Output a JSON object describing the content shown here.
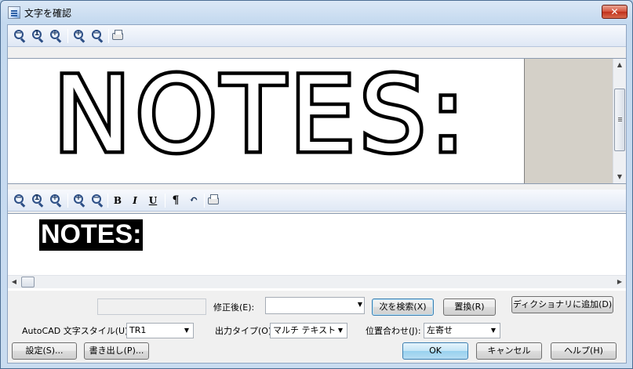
{
  "window": {
    "title": "文字を確認",
    "close_glyph": "✕"
  },
  "preview_toolbar": {
    "buttons": [
      {
        "name": "zoom-out-icon",
        "sign": "−"
      },
      {
        "name": "zoom-actual-icon",
        "sign": "1"
      },
      {
        "name": "zoom-fit-icon",
        "sign": "+"
      },
      {
        "name": "zoom-in-icon",
        "sign": "+"
      },
      {
        "name": "zoom-out-small-icon",
        "sign": "−"
      }
    ],
    "print_icon": "printer-icon"
  },
  "preview": {
    "scanned_text": "NOTES:"
  },
  "editor_toolbar": {
    "bold": "B",
    "italic": "I",
    "underline": "U",
    "pilcrow": "¶",
    "undo": "↶"
  },
  "editor": {
    "text": "NOTES:"
  },
  "correction": {
    "label": "修正後(E):",
    "value": "",
    "find_next": "次を検索(X)",
    "replace": "置換(R)",
    "add_to_dictionary": "ディクショナリに追加(D)"
  },
  "options": {
    "text_style_label": "AutoCAD 文字スタイル(U):",
    "text_style_value": "TR1",
    "output_type_label": "出力タイプ(O):",
    "output_type_value": "マルチ テキスト",
    "alignment_label": "位置合わせ(J):",
    "alignment_value": "左寄せ"
  },
  "footer": {
    "settings": "設定(S)...",
    "export": "書き出し(P)...",
    "ok": "OK",
    "cancel": "キャンセル",
    "help": "ヘルプ(H)"
  },
  "scroll": {
    "up": "▲",
    "down": "▼",
    "left": "◀",
    "right": "▶",
    "combo_arrow": "▼"
  }
}
